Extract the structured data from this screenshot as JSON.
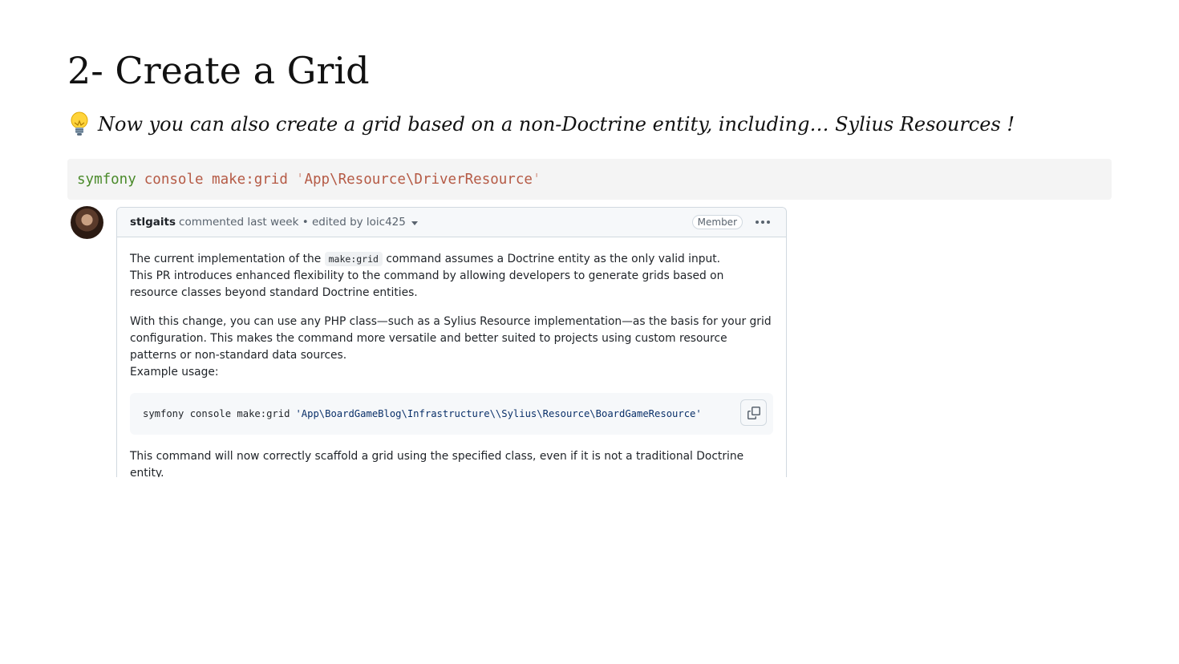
{
  "slide": {
    "title": "2- Create a Grid",
    "subtitle": "Now you can also create a grid based on a non-Doctrine entity, including… Sylius Resources !",
    "bulb_icon": "lightbulb-icon"
  },
  "command": {
    "program": "symfony",
    "rest": "console make:grid",
    "quote_open": "'",
    "argument": "App\\Resource\\DriverResource",
    "quote_close": "'"
  },
  "comment": {
    "author": "stlgaits",
    "action": "commented last week • edited by loic425",
    "badge": "Member",
    "para1_before": "The current implementation of the",
    "para1_code": "make:grid",
    "para1_after": "command assumes a Doctrine entity as the only valid input.",
    "para1_line2": "This PR introduces enhanced flexibility to the command by allowing developers to generate grids based on resource classes beyond standard Doctrine entities.",
    "para2": "With this change, you can use any PHP class—such as a Sylius Resource implementation—as the basis for your grid configuration. This makes the command more versatile and better suited to projects using custom resource patterns or non-standard data sources.",
    "para2_line2": "Example usage:",
    "code_cmd": "symfony console make:grid",
    "code_arg": "'App\\BoardGameBlog\\Infrastructure\\\\Sylius\\Resource\\BoardGameResource'",
    "para3": "This command will now correctly scaffold a grid using the specified class, even if it is not a traditional Doctrine entity."
  },
  "colors": {
    "program": "#4a8a2a",
    "command": "#b55a45",
    "code_string": "#0a3069"
  }
}
